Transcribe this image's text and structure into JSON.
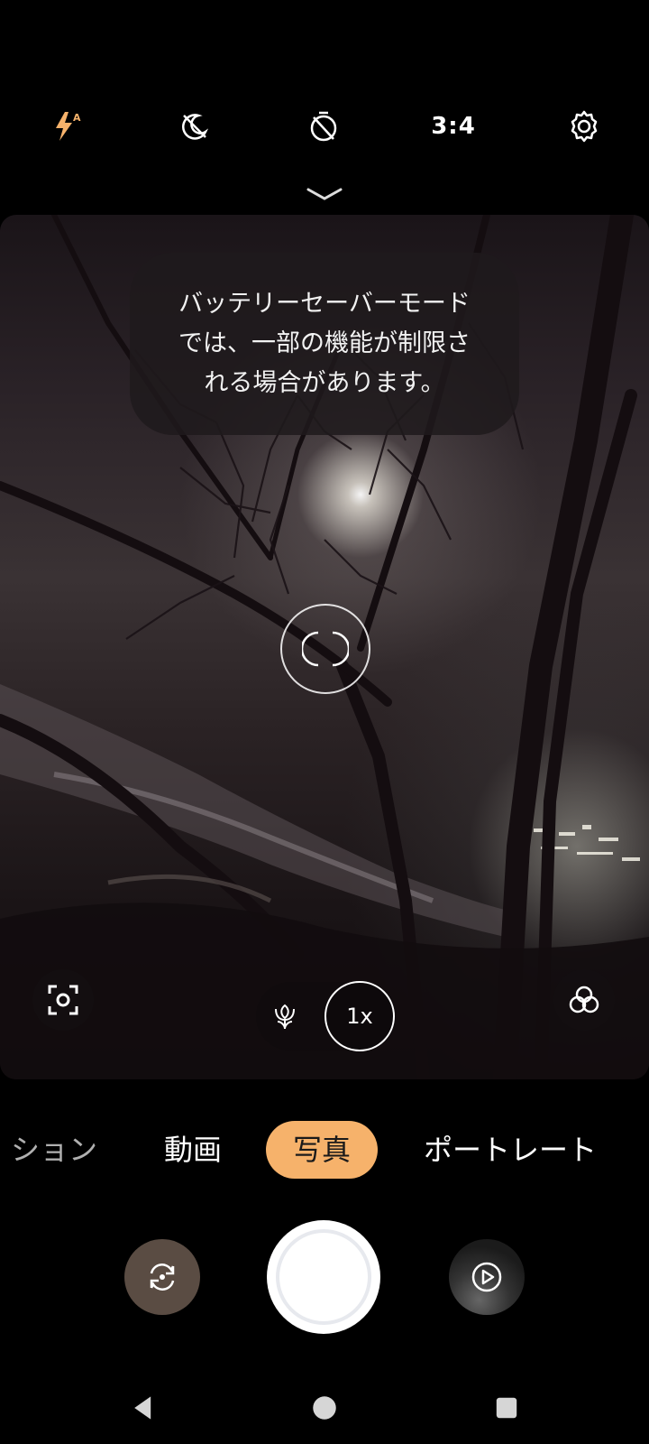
{
  "top_bar": {
    "flash_icon": "flash-auto-icon",
    "night_icon": "night-off-icon",
    "timer_icon": "timer-off-icon",
    "aspect_ratio": "3:4",
    "settings_icon": "gear-icon",
    "accent_color": "#f6b26b"
  },
  "toast": {
    "message": "バッテリーセーバーモードでは、一部の機能が制限される場合があります。"
  },
  "viewfinder": {
    "zoom_label": "1x"
  },
  "modes": {
    "items": [
      "ション",
      "動画",
      "写真",
      "ポートレート"
    ],
    "active": "写真"
  },
  "navigation": {
    "back_icon": "back-triangle-icon",
    "home_icon": "home-circle-icon",
    "recents_icon": "recents-square-icon"
  }
}
